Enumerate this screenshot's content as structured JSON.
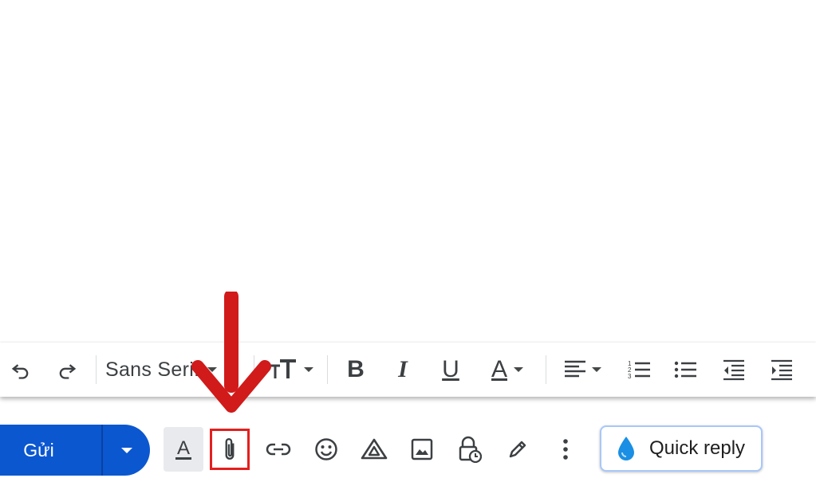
{
  "toolbar": {
    "undo_icon": "undo-icon",
    "redo_icon": "redo-icon",
    "font_name": "Sans Serif",
    "size_icon": "text-size-icon",
    "bold": "B",
    "italic": "I",
    "underline": "U",
    "text_color": "A",
    "align_icon": "align-left-icon",
    "numbered_list_icon": "numbered-list-icon",
    "bulleted_list_icon": "bulleted-list-icon",
    "indent_less_icon": "indent-less-icon",
    "indent_more_icon": "indent-more-icon"
  },
  "bottom": {
    "send_label": "Gửi",
    "formatting_label": "A",
    "attach_icon": "paperclip-icon",
    "link_icon": "link-icon",
    "emoji_icon": "emoji-icon",
    "drive_icon": "drive-icon",
    "photo_icon": "photo-icon",
    "confidential_icon": "lock-clock-icon",
    "signature_icon": "pen-icon",
    "more_icon": "more-vert-icon",
    "quick_reply_label": "Quick reply"
  },
  "colors": {
    "send_blue": "#0b57d0",
    "highlight_red": "#e41f1f",
    "arrow_red": "#d11a1a",
    "quick_reply_border": "#a8c7fa",
    "drop_blue": "#1a8fe3"
  }
}
